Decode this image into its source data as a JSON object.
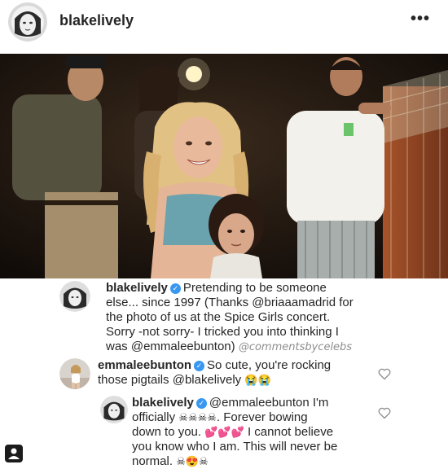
{
  "post": {
    "username": "blakelively",
    "more_icon": "more-horizontal-icon",
    "more_label": "•••"
  },
  "colors": {
    "verified_blue": "#3897f0",
    "text": "#262626",
    "muted": "#8e8e8e"
  },
  "comments": [
    {
      "username": "blakelively",
      "verified": true,
      "lines": [
        "Pretending to be someone",
        "else... since 1997 (Thanks @briaaamadrid for",
        "the photo of us at the Spice Girls concert.",
        "Sorry -not sorry- I tricked you into thinking I",
        "was @emmaleebunton)"
      ],
      "watermark": "@commentsbycelebs"
    },
    {
      "username": "emmaleebunton",
      "verified": true,
      "lines": [
        "So cute, you're rocking",
        "those pigtails @blakelively"
      ],
      "emoji": "😭😭"
    },
    {
      "username": "blakelively",
      "verified": true,
      "lines": [
        "@emmaleebunton I'm",
        "officially",
        "Forever bowing",
        "down to you.",
        "I cannot believe",
        "you know who I am. This will never be",
        "normal."
      ],
      "emoji_skulls": "☠☠☠☠",
      "emoji_hearts": "💕💕💕",
      "emoji_end": "☠😍☠"
    }
  ]
}
